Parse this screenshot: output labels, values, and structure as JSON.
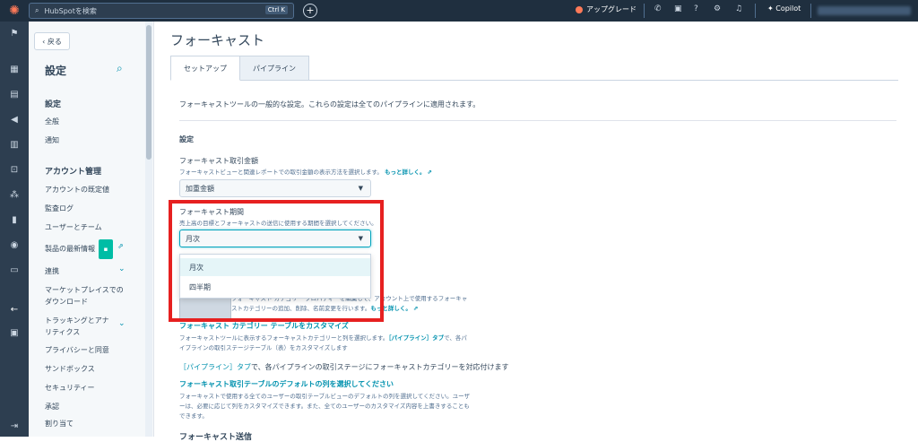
{
  "topbar": {
    "logo": "HubSpot",
    "search_placeholder": "HubSpotを検索",
    "search_shortcut": "Ctrl K",
    "upgrade_label": "アップグレード",
    "copilot_label": "Copilot"
  },
  "sidebar": {
    "back_label": "戻る",
    "title": "設定",
    "section_settings": "設定",
    "items_top": [
      "全般",
      "通知"
    ],
    "section_account": "アカウント管理",
    "items_account": [
      "アカウントの既定値",
      "監査ログ",
      "ユーザーとチーム",
      "製品の最新情報",
      "連携",
      "マーケットプレイスでの",
      "ダウンロード",
      "トラッキングとアナ",
      "リティクス",
      "プライバシーと同意",
      "サンドボックス",
      "セキュリティー",
      "承認",
      "割り当て"
    ]
  },
  "main": {
    "page_title": "フォーキャスト",
    "tabs": [
      "セットアップ",
      "パイプライン"
    ],
    "intro": "フォーキャストツールの一般的な設定。これらの設定は全てのパイプラインに適用されます。",
    "section_title": "設定",
    "amount_label": "フォーキャスト取引金額",
    "amount_help": "フォーキャストビューと関連レポートでの取引金額の表示方法を選択します。",
    "learn_more": "もっと詳しく。",
    "amount_value": "加重金額",
    "period_label": "フォーキャスト期間",
    "period_help": "売上高の目標とフォーキャストの送信に使用する期間を選択してください。",
    "period_value": "月次",
    "period_options": [
      "月次",
      "四半期"
    ],
    "category_text_1": "フォーキャスト カテゴリー プロパティーを編集して、アカウント上で使用するフォーキャ",
    "category_text_2": "ストカテゴリーの追加、削除、名前変更を行います。",
    "category_table_head": "フォーキャスト カテゴリー テーブルをカスタマイズ",
    "category_table_1a": "フォーキャストツールに表示するフォーキャストカテゴリーと列を選択します。",
    "category_table_1b": "［パイプライン］タブ",
    "category_table_1c": "で、各パ",
    "category_table_2": "イプラインの取引ステージテーブル（表）をカスタマイズします",
    "stage_link": "［パイプライン］タブ",
    "stage_text": "で、各パイプラインの取引ステージにフォーキャストカテゴリーを対応付けます",
    "default_cols_head": "フォーキャスト取引テーブルのデフォルトの列を選択してください",
    "default_cols_1": "フォーキャストで使用する全てのユーザーの取引テーブルビューのデフォルトの列を選択してください。ユーザ",
    "default_cols_2": "ーは、必要に応じて列をカスタマイズできます。また、全てのユーザーのカスタマイズ内容を上書きすることも",
    "default_cols_3": "できます。",
    "cut_title": "フォーキャスト送信"
  },
  "colors": {
    "topbar": "#1f2f3f",
    "accent": "#0091ae",
    "highlight": "#e62020",
    "badge": "#00bda5"
  }
}
